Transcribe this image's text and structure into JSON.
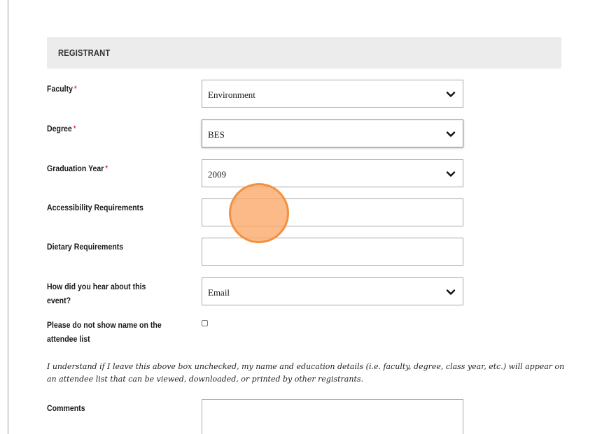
{
  "section": {
    "title": "REGISTRANT"
  },
  "required_mark": "*",
  "fields": {
    "faculty": {
      "label": "Faculty",
      "value": "Environment"
    },
    "degree": {
      "label": "Degree",
      "value": "BES"
    },
    "graduation_year": {
      "label": "Graduation Year",
      "value": "2009"
    },
    "accessibility": {
      "label": "Accessibility Requirements",
      "value": ""
    },
    "dietary": {
      "label": "Dietary Requirements",
      "value": ""
    },
    "hear_about": {
      "label": "How did you hear about this event?",
      "value": "Email"
    },
    "hide_name": {
      "label": "Please do not show name on the attendee list",
      "checked": false
    },
    "comments": {
      "label": "Comments",
      "value": ""
    }
  },
  "notice": "I understand if I leave this above box unchecked, my name and education details (i.e. faculty, degree, class year, etc.) will appear on an attendee list that can be viewed, downloaded, or printed by other registrants.",
  "colors": {
    "required": "#d0021b",
    "header_bg": "#ececec",
    "cursor_fill": "#fca668",
    "cursor_ring": "#f2913f"
  }
}
